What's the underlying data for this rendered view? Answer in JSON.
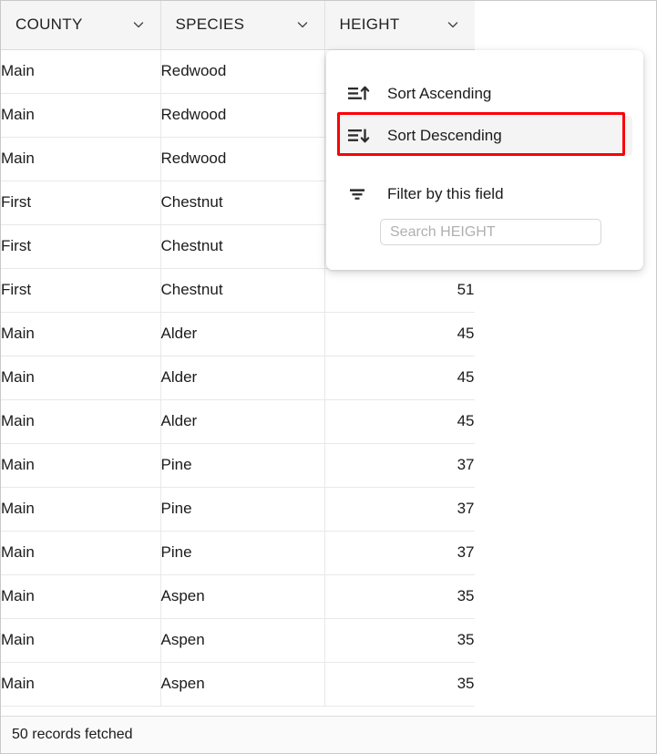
{
  "table": {
    "columns": [
      {
        "label": "COUNTY",
        "align": "left",
        "icon": "chevron-down-icon"
      },
      {
        "label": "SPECIES",
        "align": "left",
        "icon": "chevron-down-icon"
      },
      {
        "label": "HEIGHT",
        "align": "right",
        "icon": "chevron-down-icon"
      }
    ],
    "rows": [
      {
        "county": "Main",
        "species": "Redwood",
        "height": ""
      },
      {
        "county": "Main",
        "species": "Redwood",
        "height": ""
      },
      {
        "county": "Main",
        "species": "Redwood",
        "height": ""
      },
      {
        "county": "First",
        "species": "Chestnut",
        "height": ""
      },
      {
        "county": "First",
        "species": "Chestnut",
        "height": ""
      },
      {
        "county": "First",
        "species": "Chestnut",
        "height": "51"
      },
      {
        "county": "Main",
        "species": "Alder",
        "height": "45"
      },
      {
        "county": "Main",
        "species": "Alder",
        "height": "45"
      },
      {
        "county": "Main",
        "species": "Alder",
        "height": "45"
      },
      {
        "county": "Main",
        "species": "Pine",
        "height": "37"
      },
      {
        "county": "Main",
        "species": "Pine",
        "height": "37"
      },
      {
        "county": "Main",
        "species": "Pine",
        "height": "37"
      },
      {
        "county": "Main",
        "species": "Aspen",
        "height": "35"
      },
      {
        "county": "Main",
        "species": "Aspen",
        "height": "35"
      },
      {
        "county": "Main",
        "species": "Aspen",
        "height": "35"
      }
    ]
  },
  "status": {
    "records_text": "50 records fetched"
  },
  "menu": {
    "items": [
      {
        "label": "Sort Ascending",
        "icon": "sort-ascending-icon",
        "highlighted": false
      },
      {
        "label": "Sort Descending",
        "icon": "sort-descending-icon",
        "highlighted": true
      },
      {
        "label": "Filter by this field",
        "icon": "filter-icon",
        "highlighted": false
      }
    ],
    "search": {
      "placeholder": "Search HEIGHT",
      "value": ""
    }
  },
  "annotation": {
    "highlight_color": "#fb0007",
    "target": "Sort Descending"
  }
}
